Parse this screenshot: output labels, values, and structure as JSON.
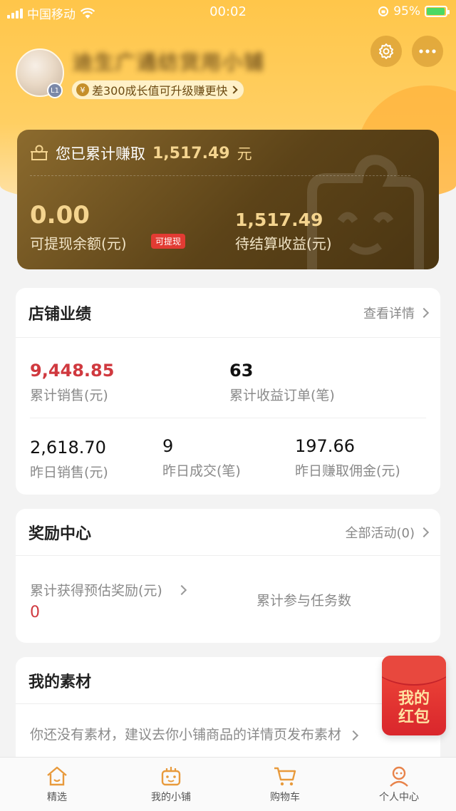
{
  "status_bar": {
    "carrier": "中国移动",
    "time": "00:02",
    "battery": "95%"
  },
  "profile": {
    "shop_name": "迪生广通纺货用小铺",
    "level_badge": "L1",
    "upgrade_tip": "差300成长值可升级赚更快"
  },
  "earnings": {
    "total_label": "您已累计赚取",
    "total_value": "1,517.49",
    "total_unit": "元",
    "balance_value": "0.00",
    "balance_label": "可提现余额(元)",
    "withdraw_badge": "可提现",
    "pending_value": "1,517.49",
    "pending_label": "待结算收益(元)"
  },
  "performance": {
    "title": "店铺业绩",
    "link": "查看详情",
    "total_sales_value": "9,448.85",
    "total_sales_label": "累计销售(元)",
    "total_orders_value": "63",
    "total_orders_label": "累计收益订单(笔)",
    "yesterday_sales_value": "2,618.70",
    "yesterday_sales_label": "昨日销售(元)",
    "yesterday_deals_value": "9",
    "yesterday_deals_label": "昨日成交(笔)",
    "yesterday_commission_value": "197.66",
    "yesterday_commission_label": "昨日赚取佣金(元)"
  },
  "rewards": {
    "title": "奖励中心",
    "link": "全部活动(0)",
    "estimated_label": "累计获得预估奖励(元)",
    "estimated_value": "0",
    "tasks_label": "累计参与任务数"
  },
  "materials": {
    "title": "我的素材",
    "empty_text": "你还没有素材，建议去你小铺商品的详情页发布素材"
  },
  "red_packet": {
    "line1": "我的",
    "line2": "红包"
  },
  "tabbar": {
    "items": [
      {
        "label": "精选",
        "icon": "home-icon"
      },
      {
        "label": "我的小铺",
        "icon": "shop-icon"
      },
      {
        "label": "购物车",
        "icon": "cart-icon"
      },
      {
        "label": "个人中心",
        "icon": "user-icon"
      }
    ]
  },
  "colors": {
    "header": "#ffc64a",
    "card_dark": "#5c4318",
    "gold_text": "#f4d48f",
    "red_value": "#d0393f",
    "tab_active": "#e8834a"
  }
}
